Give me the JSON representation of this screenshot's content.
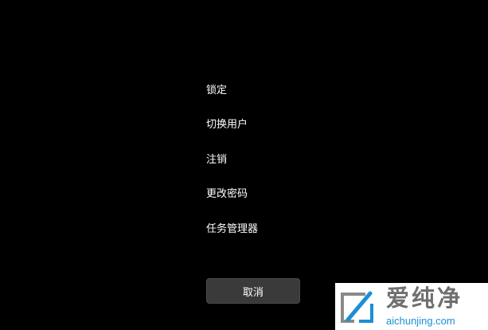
{
  "menu": {
    "items": [
      {
        "label": "锁定"
      },
      {
        "label": "切换用户"
      },
      {
        "label": "注销"
      },
      {
        "label": "更改密码"
      },
      {
        "label": "任务管理器"
      }
    ]
  },
  "cancel_button": {
    "label": "取消"
  },
  "watermark": {
    "brand": "爱纯净",
    "domain": "aichunjing.com",
    "logo_icon": "slash-logo-icon"
  },
  "colors": {
    "background": "#000000",
    "menu_text": "#ffffff",
    "button_bg": "#3a3a3a",
    "watermark_bg": "#ffffff",
    "watermark_brand": "#6f6f6f",
    "watermark_domain": "#1a8fd6"
  }
}
